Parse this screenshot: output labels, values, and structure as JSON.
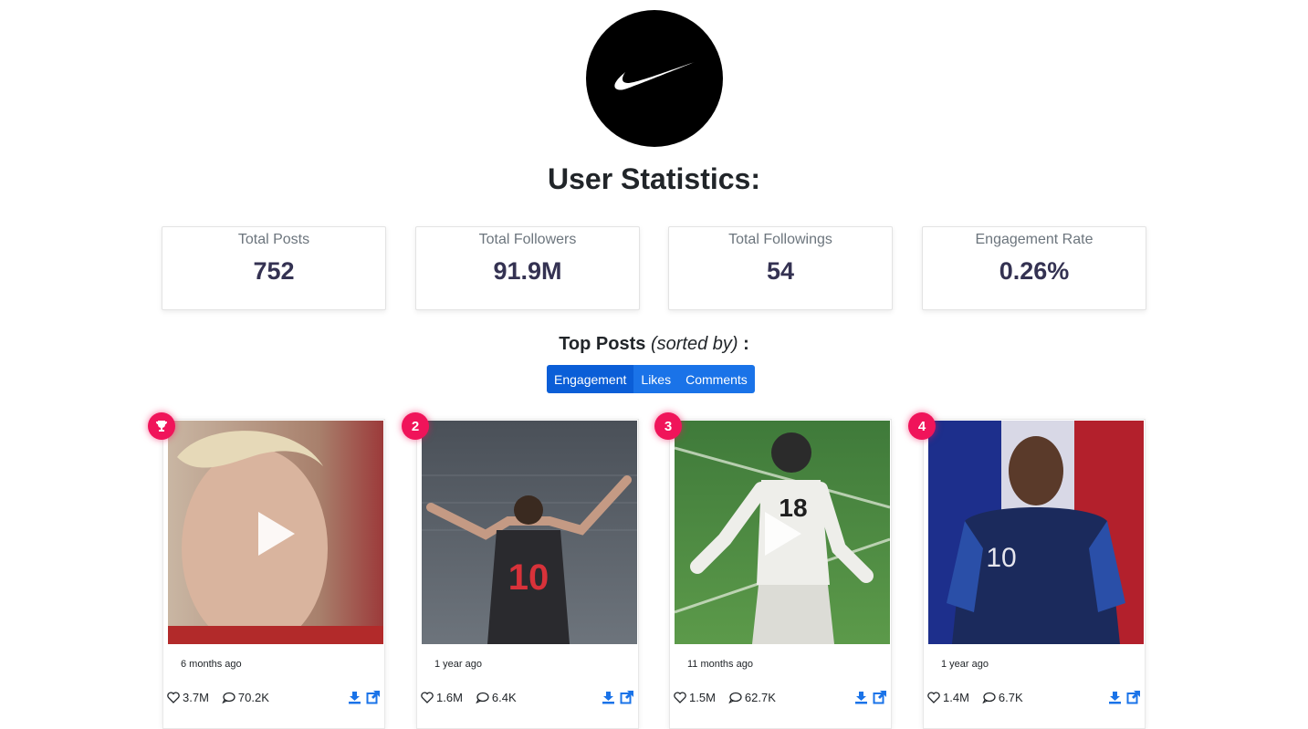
{
  "header": {
    "logo": "nike-swoosh-logo",
    "title": "User Statistics:"
  },
  "stats": [
    {
      "label": "Total Posts",
      "value": "752"
    },
    {
      "label": "Total Followers",
      "value": "91.9M"
    },
    {
      "label": "Total Followings",
      "value": "54"
    },
    {
      "label": "Engagement Rate",
      "value": "0.26%"
    }
  ],
  "top_posts": {
    "heading": "Top Posts",
    "subheading": "(sorted by)",
    "colon": ":",
    "sort_options": [
      "Engagement",
      "Likes",
      "Comments"
    ],
    "selected": "Engagement"
  },
  "posts": [
    {
      "rank": "trophy-icon",
      "time": "6 months ago",
      "likes": "3.7M",
      "comments": "70.2K",
      "video": true
    },
    {
      "rank": "2",
      "time": "1 year ago",
      "likes": "1.6M",
      "comments": "6.4K",
      "video": false
    },
    {
      "rank": "3",
      "time": "11 months ago",
      "likes": "1.5M",
      "comments": "62.7K",
      "video": true
    },
    {
      "rank": "4",
      "time": "1 year ago",
      "likes": "1.4M",
      "comments": "6.7K",
      "video": false
    }
  ],
  "colors": {
    "accent": "#1a73e8",
    "badge": "#f0145a",
    "stat_value": "#343252"
  }
}
